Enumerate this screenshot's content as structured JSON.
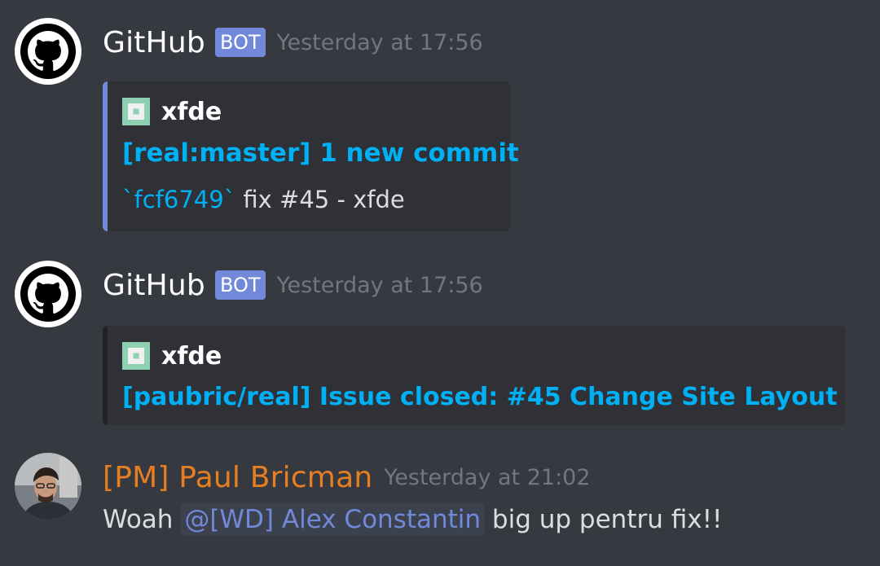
{
  "colors": {
    "background": "#36393f",
    "embed_bg": "#2f3136",
    "link": "#00b0f4",
    "bot_tag": "#7289da",
    "timestamp": "#72767d",
    "pm_name": "#e67e22",
    "mention": "#7289da"
  },
  "messages": [
    {
      "author": "GitHub",
      "tag": "BOT",
      "timestamp": "Yesterday at 17:56",
      "avatar_icon": "github-octocat-icon",
      "embed": {
        "author": "xfde",
        "author_icon": "identicon-icon",
        "title": "[real:master] 1 new commit",
        "commit_hash": "`fcf6749`",
        "commit_message": " fix #45 - xfde"
      }
    },
    {
      "author": "GitHub",
      "tag": "BOT",
      "timestamp": "Yesterday at 17:56",
      "avatar_icon": "github-octocat-icon",
      "embed": {
        "author": "xfde",
        "author_icon": "identicon-icon",
        "title": "[paubric/real] Issue closed: #45 Change Site Layout"
      }
    },
    {
      "author": "[PM] Paul Bricman",
      "timestamp": "Yesterday at 21:02",
      "avatar_icon": "user-photo-avatar",
      "content_before": "Woah ",
      "mention": "@[WD] Alex Constantin",
      "content_after": " big up pentru fix!!"
    }
  ]
}
